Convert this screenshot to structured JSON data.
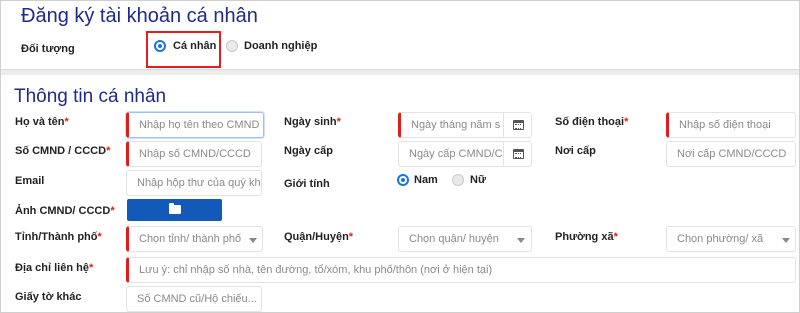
{
  "header": {
    "title": "Đăng ký tài khoản cá nhân",
    "subject_label": "Đối tượng",
    "subject_options": [
      {
        "label": "Cá nhân",
        "selected": true
      },
      {
        "label": "Doanh nghiệp",
        "selected": false
      }
    ]
  },
  "section": {
    "title": "Thông tin cá nhân"
  },
  "form": {
    "full_name": {
      "label": "Họ và tên",
      "required": "*",
      "placeholder": "Nhập họ tên theo CMND"
    },
    "dob": {
      "label": "Ngày sinh",
      "required": "*",
      "placeholder": "Ngày tháng năm s"
    },
    "phone": {
      "label": "Số điện thoại",
      "required": "*",
      "placeholder": "Nhập số điện thoại"
    },
    "id_number": {
      "label": "Số CMND / CCCD",
      "required": "*",
      "placeholder": "Nhập số CMND/CCCD"
    },
    "issue_date": {
      "label": "Ngày cấp",
      "placeholder": "Ngày cấp CMND/C"
    },
    "issue_place": {
      "label": "Nơi cấp",
      "placeholder": "Nơi cấp CMND/CCCD"
    },
    "email": {
      "label": "Email",
      "placeholder": "Nhập hộp thư của quý kh"
    },
    "gender": {
      "label": "Giới tính",
      "options": [
        {
          "label": "Nam",
          "selected": true
        },
        {
          "label": "Nữ",
          "selected": false
        }
      ]
    },
    "id_photo": {
      "label": "Ảnh CMND/ CCCD",
      "required": "*",
      "icon": "folder-open-icon"
    },
    "province": {
      "label": "Tỉnh/Thành phố",
      "required": "*",
      "placeholder": "Chọn tỉnh/ thành phố"
    },
    "district": {
      "label": "Quận/Huyện",
      "required": "*",
      "placeholder": "Chọn quận/ huyện"
    },
    "ward": {
      "label": "Phường xã",
      "required": "*",
      "placeholder": "Chọn phường/ xã"
    },
    "address": {
      "label": "Địa chỉ liên hệ",
      "required": "*",
      "placeholder": "Lưu ý: chỉ nhập số nhà, tên đường, tổ/xóm, khu phố/thôn (nơi ở hiện tại)"
    },
    "other_docs": {
      "label": "Giấy tờ khác",
      "placeholder": "Số CMND cũ/Hộ chiếu..."
    }
  },
  "colors": {
    "title": "#1f2a8c",
    "required": "#e21b1b",
    "primary": "#1259b8",
    "radio_accent": "#1a73e8",
    "highlight": "#e11d1d"
  }
}
